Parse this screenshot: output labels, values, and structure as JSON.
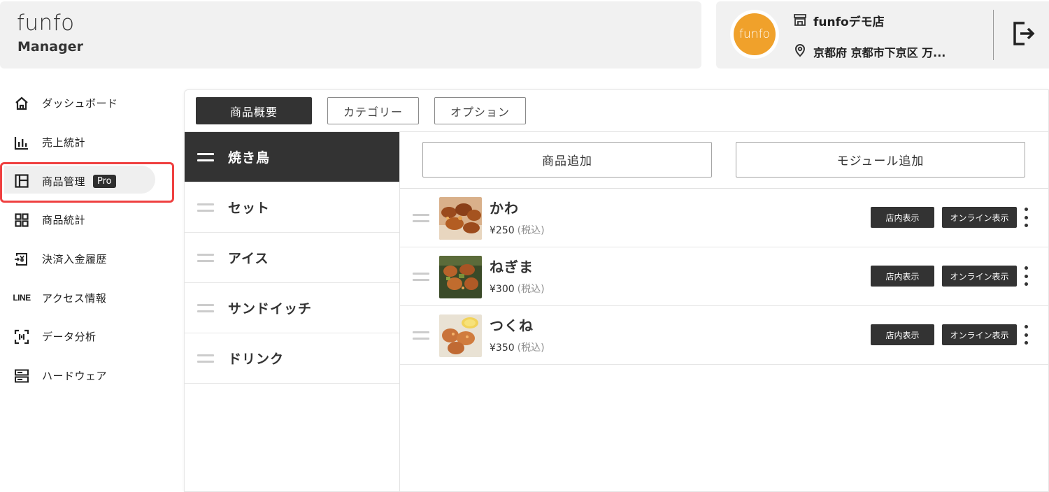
{
  "header": {
    "logo_line1": "funfo",
    "logo_line2": "Manager",
    "avatar_text": "funfo",
    "store_name": "funfoデモ店",
    "store_address": "京都府 京都市下京区 万...",
    "icons": {
      "store": "store-icon",
      "location": "location-pin-icon",
      "logout": "logout-icon"
    }
  },
  "sidebar": {
    "items": [
      {
        "label": "ダッシュボード",
        "icon": "home-icon"
      },
      {
        "label": "売上統計",
        "icon": "bar-chart-icon"
      },
      {
        "label": "商品管理",
        "icon": "layout-icon",
        "badge": "Pro",
        "active": true
      },
      {
        "label": "商品統計",
        "icon": "grid-icon"
      },
      {
        "label": "決済入金履歴",
        "icon": "yen-transfer-icon"
      },
      {
        "label": "アクセス情報",
        "icon": "line-logo-icon",
        "icon_text": "LINE"
      },
      {
        "label": "データ分析",
        "icon": "scan-icon"
      },
      {
        "label": "ハードウェア",
        "icon": "hardware-icon"
      }
    ]
  },
  "tabs": [
    {
      "label": "商品概要",
      "active": true
    },
    {
      "label": "カテゴリー"
    },
    {
      "label": "オプション"
    }
  ],
  "categories": [
    {
      "label": "焼き鳥",
      "active": true
    },
    {
      "label": "セット"
    },
    {
      "label": "アイス"
    },
    {
      "label": "サンドイッチ"
    },
    {
      "label": "ドリンク"
    }
  ],
  "actions": {
    "add_product": "商品追加",
    "add_module": "モジュール追加"
  },
  "products": [
    {
      "name": "かわ",
      "price": "¥250",
      "tax": "(税込)",
      "store_display": "店内表示",
      "online_display": "オンライン表示"
    },
    {
      "name": "ねぎま",
      "price": "¥300",
      "tax": "(税込)",
      "store_display": "店内表示",
      "online_display": "オンライン表示"
    },
    {
      "name": "つくね",
      "price": "¥350",
      "tax": "(税込)",
      "store_display": "店内表示",
      "online_display": "オンライン表示"
    }
  ],
  "colors": {
    "accent": "#333333",
    "highlight": "#ef4040",
    "avatar": "#f0a12b",
    "header_bg": "#f1f1f1"
  }
}
